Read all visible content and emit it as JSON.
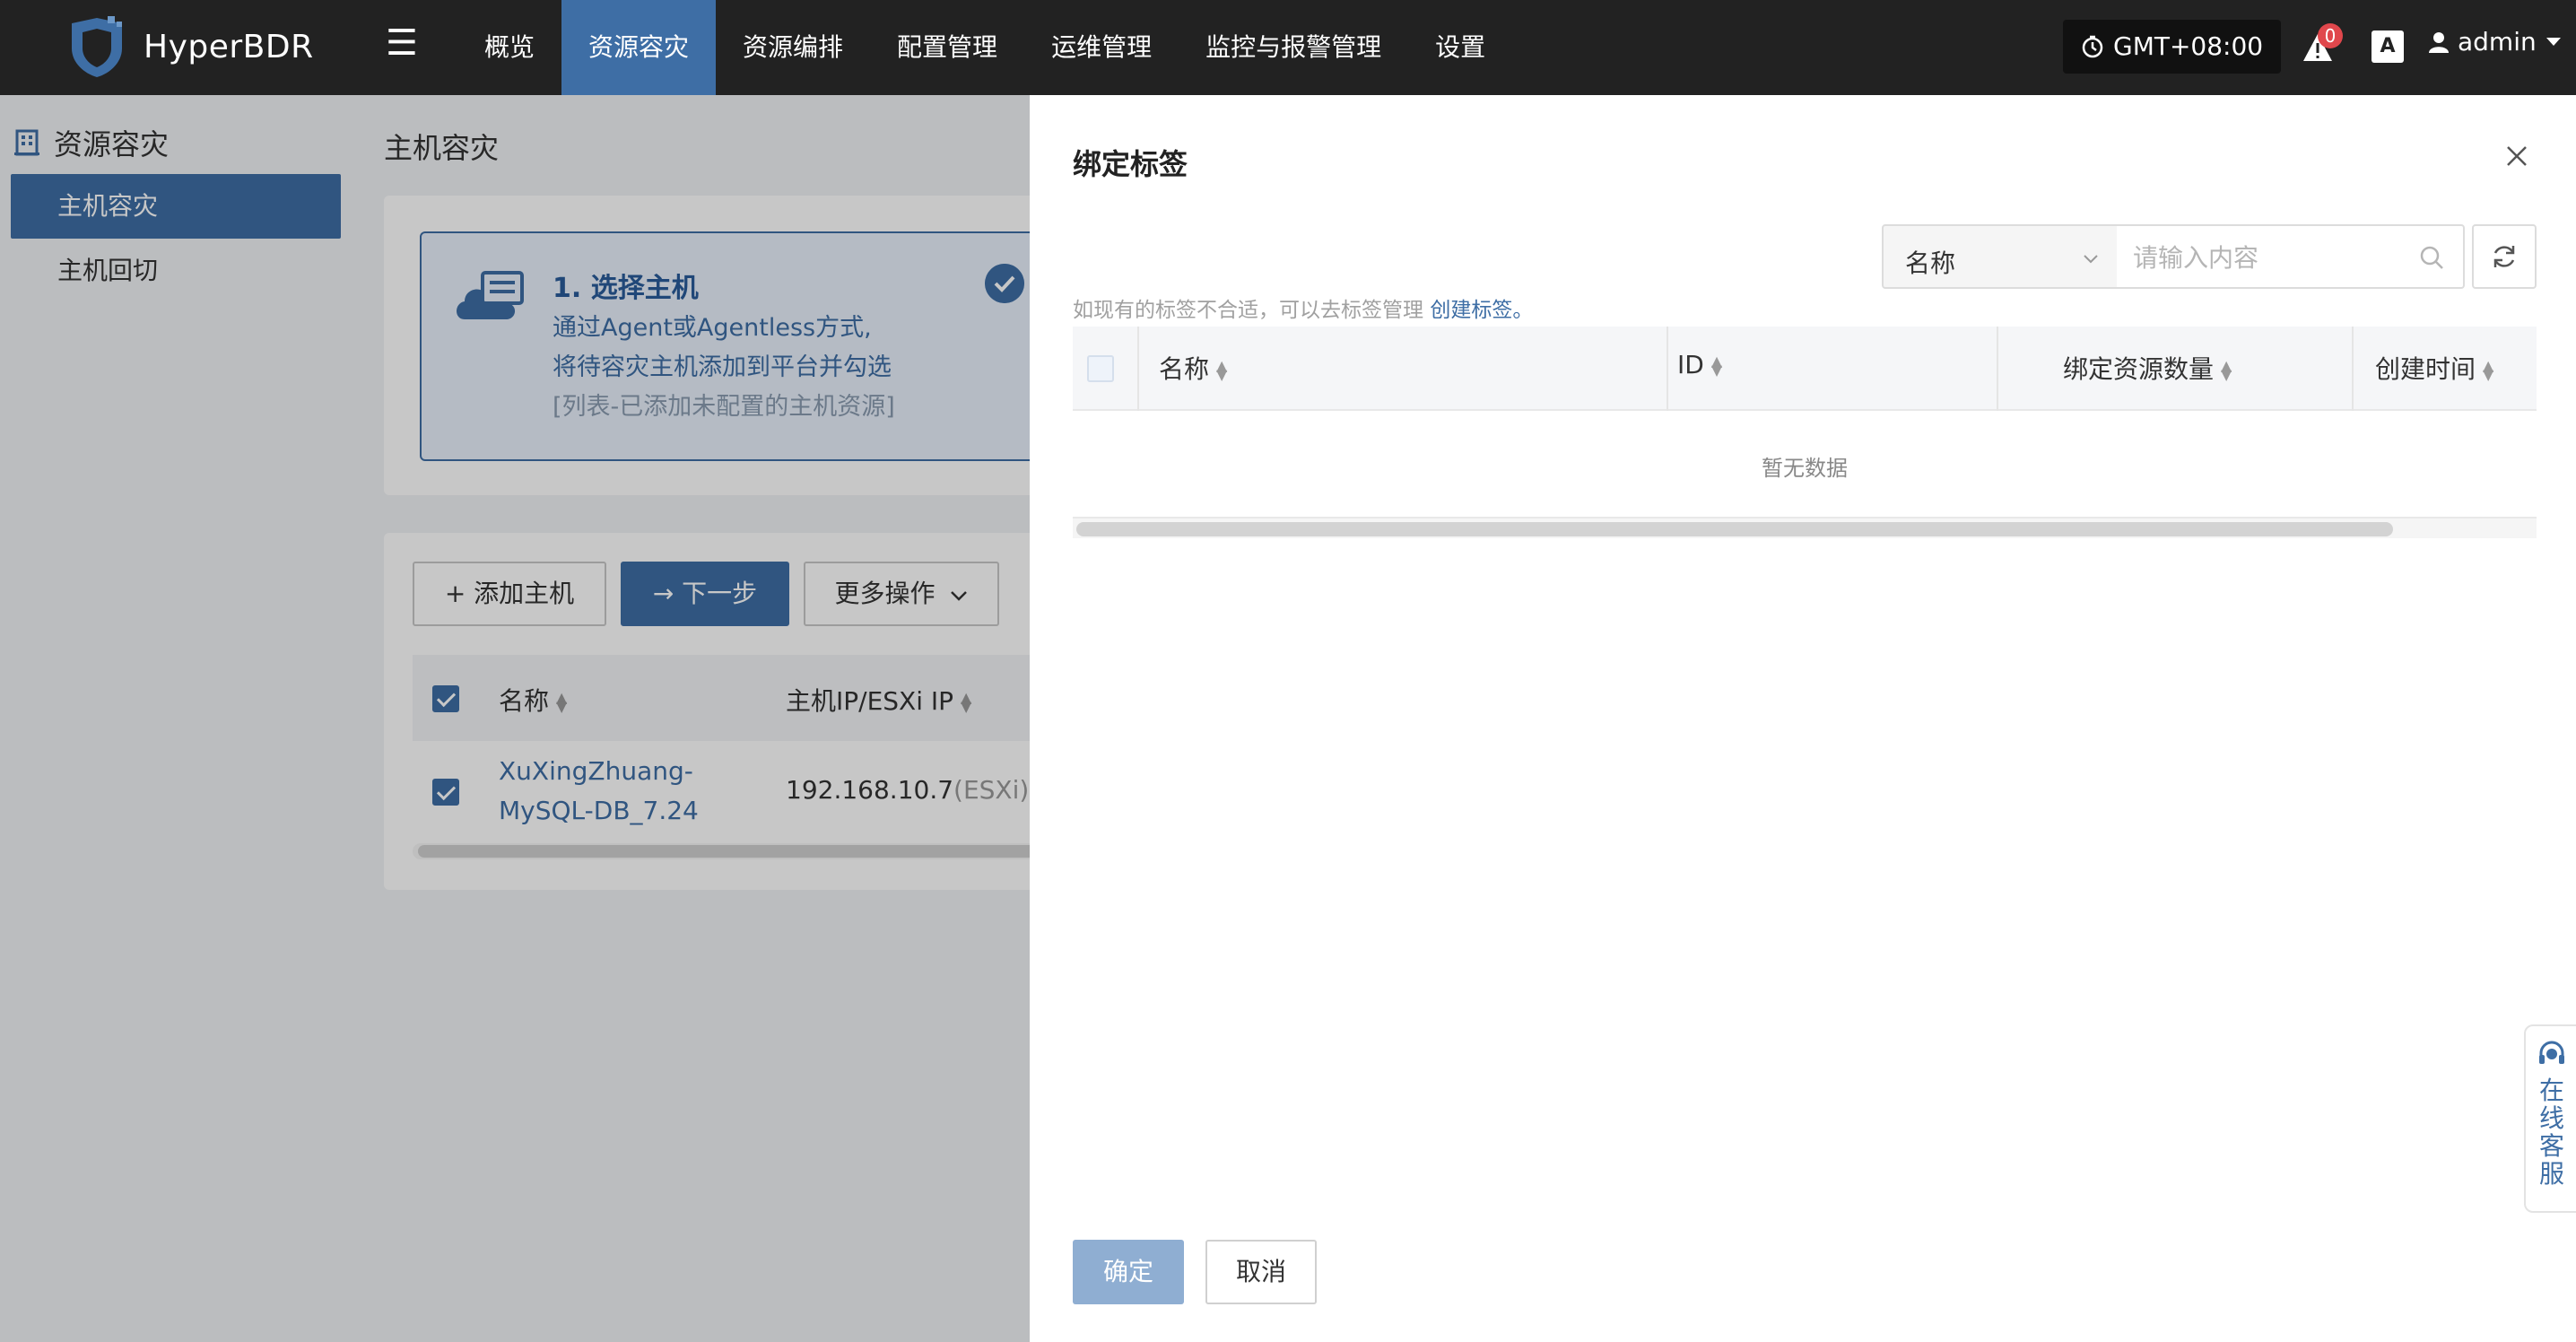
{
  "app": {
    "name": "HyperBDR"
  },
  "nav": {
    "items": [
      {
        "label": "概览",
        "active": false
      },
      {
        "label": "资源容灾",
        "active": true
      },
      {
        "label": "资源编排",
        "active": false
      },
      {
        "label": "配置管理",
        "active": false
      },
      {
        "label": "运维管理",
        "active": false
      },
      {
        "label": "监控与报警管理",
        "active": false
      },
      {
        "label": "设置",
        "active": false
      }
    ]
  },
  "header": {
    "timezone": "GMT+08:00",
    "alert_count": "0",
    "lang_label": "A",
    "user": "admin"
  },
  "sidebar": {
    "section": "资源容灾",
    "items": [
      {
        "label": "主机容灾",
        "active": true
      },
      {
        "label": "主机回切",
        "active": false
      }
    ]
  },
  "main": {
    "title": "主机容灾",
    "step": {
      "title": "1. 选择主机",
      "desc_line1": "通过Agent或Agentless方式,",
      "desc_line2": "将待容灾主机添加到平台并勾选",
      "desc_line3": "[列表-已添加未配置的主机资源]"
    },
    "toolbar": {
      "add_host": "+ 添加主机",
      "next_step": "→ 下一步",
      "more_actions": "更多操作"
    },
    "table": {
      "columns": [
        "名称",
        "主机IP/ESXi IP"
      ],
      "rows": [
        {
          "name_line1": "XuXingZhuang-",
          "name_line2": "MySQL-DB_7.24",
          "ip": "192.168.10.7",
          "ip_suffix": "(ESXi)"
        }
      ]
    }
  },
  "drawer": {
    "title": "绑定标签",
    "filter_field": "名称",
    "search_placeholder": "请输入内容",
    "hint_text": "如现有的标签不合适，可以去标签管理",
    "hint_link": "创建标签。",
    "columns": [
      "名称",
      "ID",
      "绑定资源数量",
      "创建时间"
    ],
    "empty_text": "暂无数据",
    "confirm": "确定",
    "cancel": "取消"
  },
  "support": {
    "label": "在线客服"
  },
  "colors": {
    "primary": "#3e6ea5",
    "topbar": "#222222",
    "alert": "#e0474c"
  }
}
